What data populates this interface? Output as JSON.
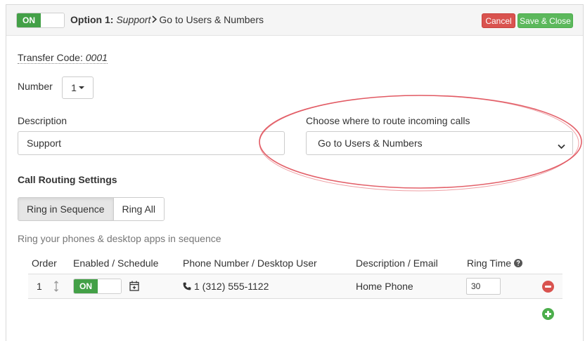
{
  "colors": {
    "on_green": "#43a047",
    "cancel_red": "#d9534f",
    "save_green": "#5cb85c",
    "annotation_red": "#e0505a"
  },
  "header": {
    "toggle_on": "ON",
    "option_prefix": "Option 1:",
    "option_name": "Support",
    "destination": "Go to Users & Numbers",
    "cancel_label": "Cancel",
    "save_label": "Save & Close"
  },
  "form": {
    "transfer_label": "Transfer Code:",
    "transfer_code": "0001",
    "number_label": "Number",
    "number_value": "1",
    "description_label": "Description",
    "description_value": "Support",
    "route_label": "Choose where to route incoming calls",
    "route_value": "Go to Users & Numbers"
  },
  "routing": {
    "title": "Call Routing Settings",
    "modes": [
      "Ring in Sequence",
      "Ring All"
    ],
    "description": "Ring your phones & desktop apps in sequence",
    "columns": [
      "Order",
      "Enabled / Schedule",
      "Phone Number / Desktop User",
      "Description / Email",
      "Ring Time"
    ],
    "rows": [
      {
        "order": "1",
        "toggle": "ON",
        "phone": "1 (312) 555-1122",
        "description": "Home Phone",
        "ring_time": "30"
      }
    ]
  }
}
